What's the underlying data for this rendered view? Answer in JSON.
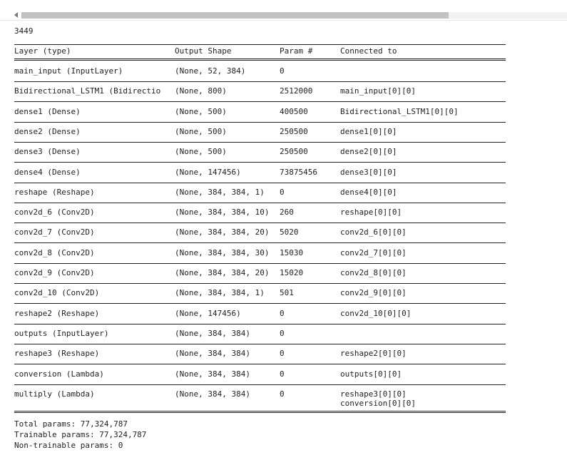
{
  "output_counter": "3449",
  "summary": {
    "headers": {
      "layer": "Layer (type)",
      "shape": "Output Shape",
      "params": "Param #",
      "connected": "Connected to"
    },
    "rows": [
      {
        "layer": "main_input (InputLayer)",
        "shape": "(None, 52, 384)",
        "params": "0",
        "connected": []
      },
      {
        "layer": "Bidirectional_LSTM1 (Bidirectio",
        "shape": "(None, 800)",
        "params": "2512000",
        "connected": [
          "main_input[0][0]"
        ]
      },
      {
        "layer": "dense1 (Dense)",
        "shape": "(None, 500)",
        "params": "400500",
        "connected": [
          "Bidirectional_LSTM1[0][0]"
        ]
      },
      {
        "layer": "dense2 (Dense)",
        "shape": "(None, 500)",
        "params": "250500",
        "connected": [
          "dense1[0][0]"
        ]
      },
      {
        "layer": "dense3 (Dense)",
        "shape": "(None, 500)",
        "params": "250500",
        "connected": [
          "dense2[0][0]"
        ]
      },
      {
        "layer": "dense4 (Dense)",
        "shape": "(None, 147456)",
        "params": "73875456",
        "connected": [
          "dense3[0][0]"
        ]
      },
      {
        "layer": "reshape (Reshape)",
        "shape": "(None, 384, 384, 1)",
        "params": "0",
        "connected": [
          "dense4[0][0]"
        ]
      },
      {
        "layer": "conv2d_6 (Conv2D)",
        "shape": "(None, 384, 384, 10)",
        "params": "260",
        "connected": [
          "reshape[0][0]"
        ]
      },
      {
        "layer": "conv2d_7 (Conv2D)",
        "shape": "(None, 384, 384, 20)",
        "params": "5020",
        "connected": [
          "conv2d_6[0][0]"
        ]
      },
      {
        "layer": "conv2d_8 (Conv2D)",
        "shape": "(None, 384, 384, 30)",
        "params": "15030",
        "connected": [
          "conv2d_7[0][0]"
        ]
      },
      {
        "layer": "conv2d_9 (Conv2D)",
        "shape": "(None, 384, 384, 20)",
        "params": "15020",
        "connected": [
          "conv2d_8[0][0]"
        ]
      },
      {
        "layer": "conv2d_10 (Conv2D)",
        "shape": "(None, 384, 384, 1)",
        "params": "501",
        "connected": [
          "conv2d_9[0][0]"
        ]
      },
      {
        "layer": "reshape2 (Reshape)",
        "shape": "(None, 147456)",
        "params": "0",
        "connected": [
          "conv2d_10[0][0]"
        ]
      },
      {
        "layer": "outputs (InputLayer)",
        "shape": "(None, 384, 384)",
        "params": "0",
        "connected": []
      },
      {
        "layer": "reshape3 (Reshape)",
        "shape": "(None, 384, 384)",
        "params": "0",
        "connected": [
          "reshape2[0][0]"
        ]
      },
      {
        "layer": "conversion (Lambda)",
        "shape": "(None, 384, 384)",
        "params": "0",
        "connected": [
          "outputs[0][0]"
        ]
      },
      {
        "layer": "multiply (Lambda)",
        "shape": "(None, 384, 384)",
        "params": "0",
        "connected": [
          "reshape3[0][0]",
          "conversion[0][0]"
        ]
      }
    ],
    "totals": {
      "total": "Total params: 77,324,787",
      "trainable": "Trainable params: 77,324,787",
      "non_trainable": "Non-trainable params: 0"
    }
  }
}
